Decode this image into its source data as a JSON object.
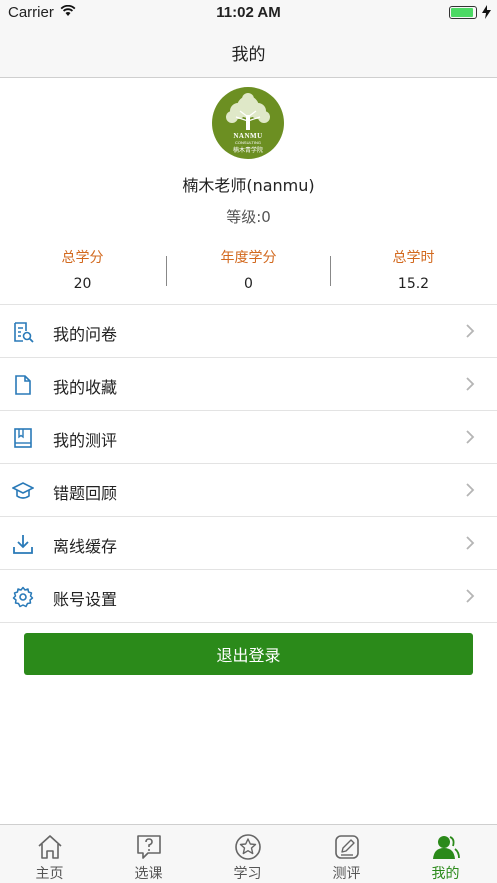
{
  "status_bar": {
    "carrier": "Carrier",
    "time": "11:02 AM",
    "battery_level": 0.9
  },
  "nav": {
    "title": "我的"
  },
  "avatar": {
    "brand": "NANMU",
    "brand_sub": "CONSULTING",
    "brand_cn": "楠木青学院"
  },
  "profile": {
    "name": "楠木老师(nanmu)",
    "level": "等级:0"
  },
  "stats": [
    {
      "label": "总学分",
      "value": "20"
    },
    {
      "label": "年度学分",
      "value": "0"
    },
    {
      "label": "总学时",
      "value": "15.2"
    }
  ],
  "menu": [
    {
      "label": "我的问卷",
      "icon": "survey-icon"
    },
    {
      "label": "我的收藏",
      "icon": "document-icon"
    },
    {
      "label": "我的测评",
      "icon": "book-icon"
    },
    {
      "label": "错题回顾",
      "icon": "graduation-cap-icon"
    },
    {
      "label": "离线缓存",
      "icon": "download-icon"
    },
    {
      "label": "账号设置",
      "icon": "gear-icon"
    }
  ],
  "logout_label": "退出登录",
  "tabs": [
    {
      "label": "主页",
      "icon": "home-icon"
    },
    {
      "label": "选课",
      "icon": "question-icon"
    },
    {
      "label": "学习",
      "icon": "star-icon"
    },
    {
      "label": "测评",
      "icon": "edit-icon"
    },
    {
      "label": "我的",
      "icon": "user-icon"
    }
  ],
  "colors": {
    "accent": "#2b8a1a",
    "stat_label": "#d2691e",
    "icon_blue": "#2a7ab8"
  }
}
